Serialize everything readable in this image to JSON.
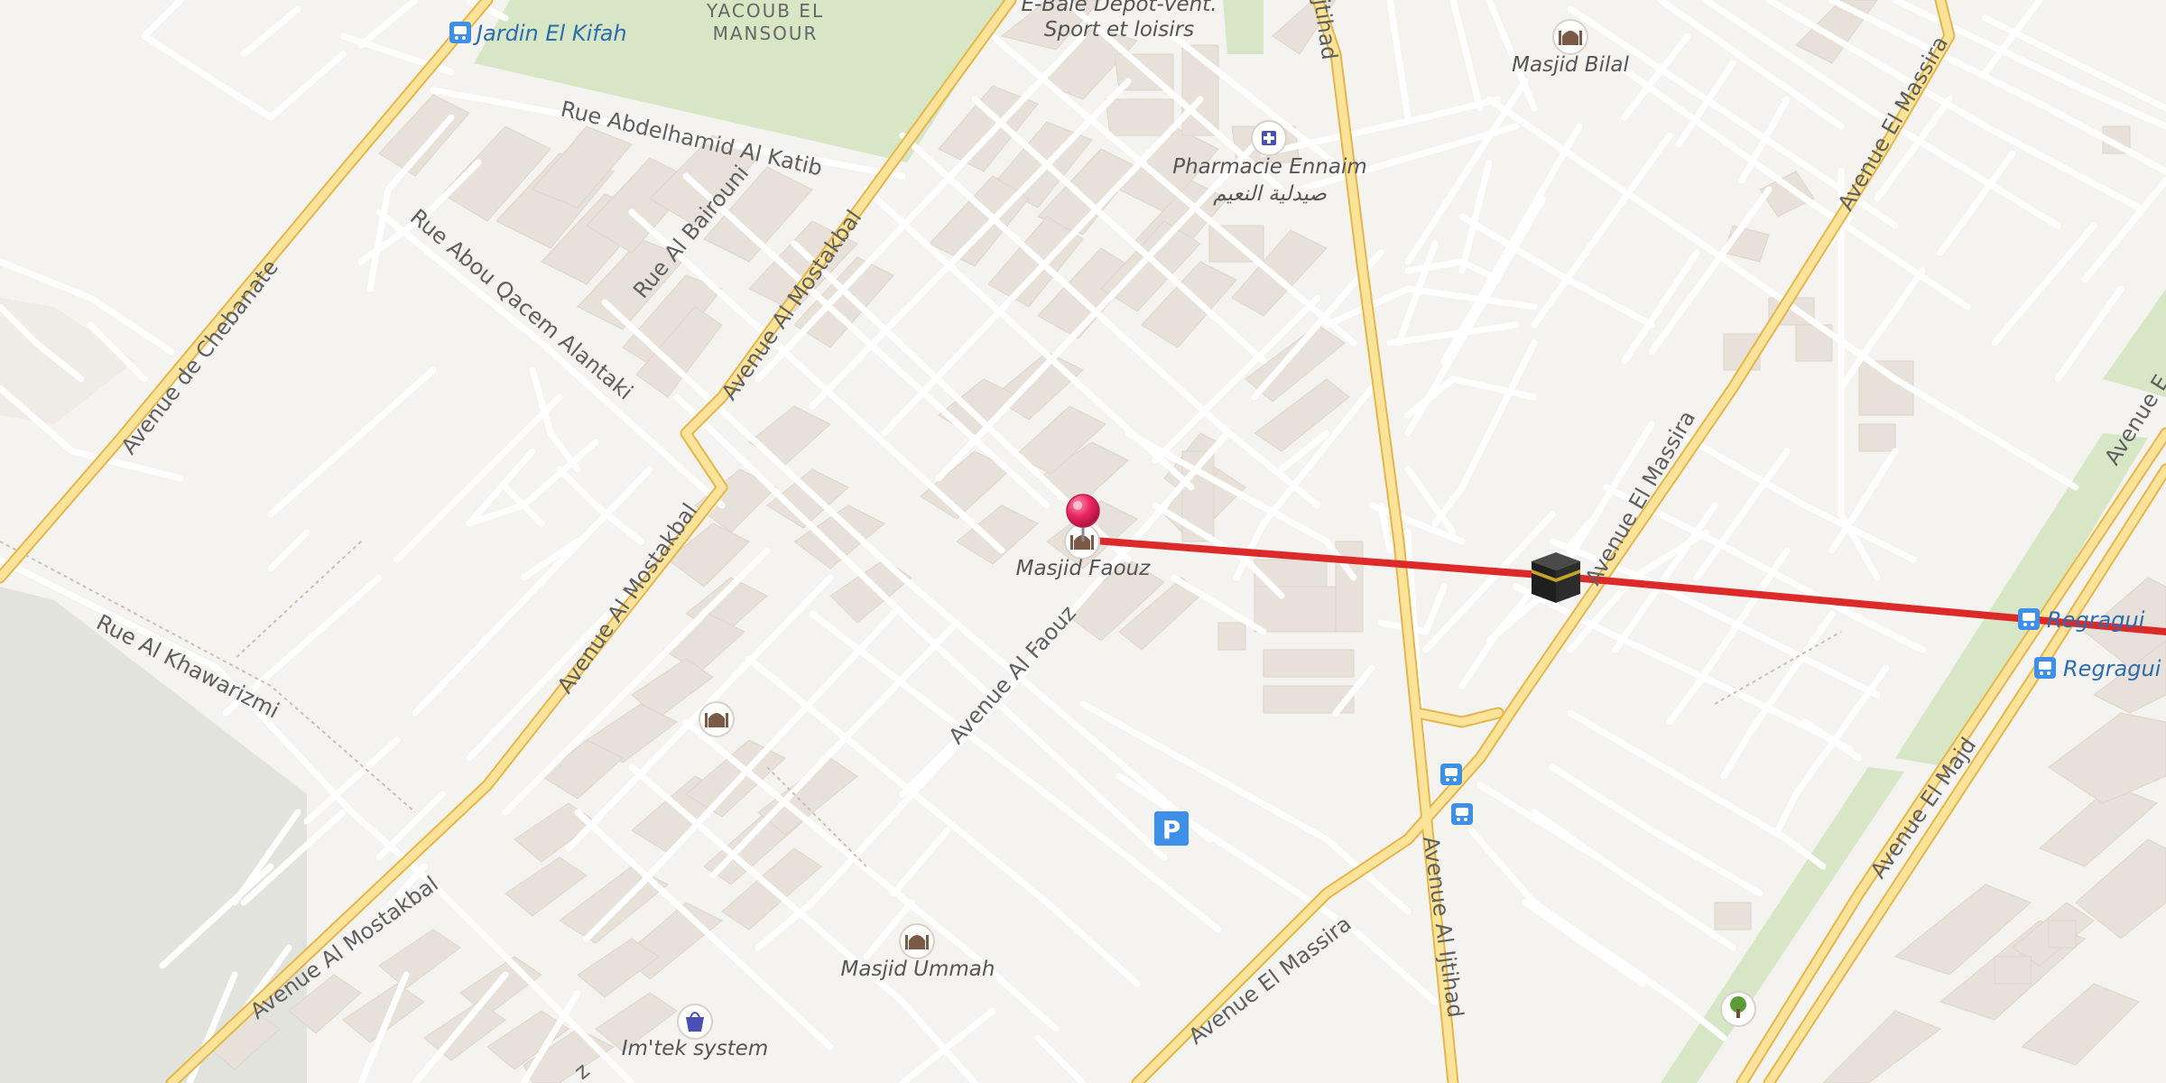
{
  "map": {
    "roads": {
      "rue_abdelhamid": "Rue Abdelhamid Al Katib",
      "rue_abou_qacem": "Rue Abou Qacem Alantaki",
      "rue_al_bairouni": "Rue Al Bairouni",
      "avenue_chebanate": "Avenue de Chebanate",
      "avenue_mostakbal": "Avenue Al Mostakbal",
      "rue_khawarizmi": "Rue Al Khawarizmi",
      "avenue_faouz": "Avenue Al Faouz",
      "avenue_massira": "Avenue El Massira",
      "avenue_ijtihad": "Avenue Al Ijtihad",
      "ijtihad_fragment": "jtihad",
      "avenue_majd": "Avenue El Majd",
      "rue_z_fragment": "z"
    },
    "areas": {
      "yacoub_line1": "YACOUB EL",
      "yacoub_line2": "MANSOUR"
    },
    "pois": {
      "jardin": "Jardin El Kifah",
      "ebale_line1": "E-Bale Depot-vent.",
      "ebale_line2": "Sport et loisirs",
      "masjid_bilal": "Masjid Bilal",
      "pharmacie": "Pharmacie Ennaim",
      "pharmacie_ar": "صيدلية النعيم",
      "masjid_faouz": "Masjid Faouz",
      "masjid_ummah": "Masjid Ummah",
      "imtek": "Im'tek system",
      "regragui_1": "Regragui",
      "regragui_2": "Regragui",
      "parking": "P"
    },
    "icons": {
      "bus": "bus-stop-icon",
      "mosque": "mosque-icon",
      "pharmacy": "pharmacy-icon",
      "shop": "shopping-bag-icon",
      "park": "tree-icon",
      "parking": "parking-icon",
      "pin": "location-pin-icon",
      "qibla": "kaaba-icon"
    },
    "colors": {
      "background": "#f5f3f0",
      "major_road": "#f3cc6e",
      "minor_road": "#ffffff",
      "building": "#e8e1d9",
      "park": "#d7e7c6",
      "route": "#dc2a2a",
      "pin": "#e8265e",
      "bus": "#3d8fe8"
    }
  }
}
